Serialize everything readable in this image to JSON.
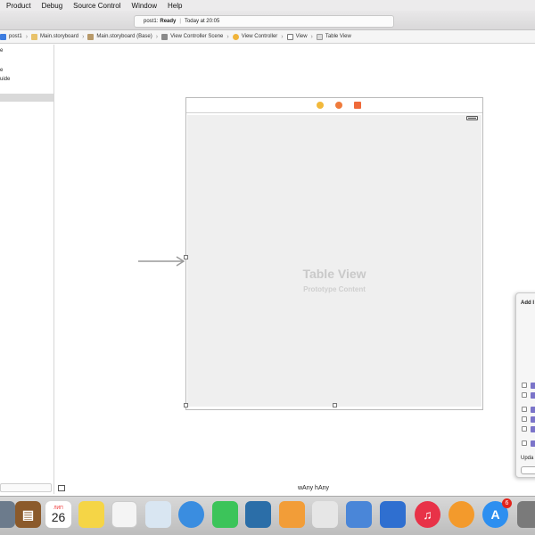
{
  "menu": [
    "Product",
    "Debug",
    "Source Control",
    "Window",
    "Help"
  ],
  "status": {
    "project": "post1:",
    "state": "Ready",
    "time": "Today at 20:05"
  },
  "breadcrumbs": [
    "post1",
    "Main.storyboard",
    "Main.storyboard (Base)",
    "View Controller Scene",
    "View Controller",
    "View",
    "Table View"
  ],
  "outline": {
    "rows": [
      "e",
      "e",
      "uide"
    ]
  },
  "scene": {
    "title": "Table View",
    "subtitle": "Prototype Content"
  },
  "add_panel": {
    "title": "Add I",
    "update_label": "Upda"
  },
  "size_class": {
    "label": "wAny  hAny"
  },
  "dock": {
    "calendar": {
      "month": "ЛИП",
      "day": "26"
    },
    "app_store_badge": "6",
    "apps": [
      "contacts",
      "calendar",
      "notes",
      "reminders",
      "preview",
      "messages",
      "facetime",
      "iphoto",
      "pages",
      "numbers",
      "keynote",
      "xcode",
      "itunes",
      "ibooks",
      "app-store",
      "system-preferences"
    ]
  },
  "colors": {
    "accent_icon": "#7b74c9",
    "dock_red": "#e3231c"
  }
}
